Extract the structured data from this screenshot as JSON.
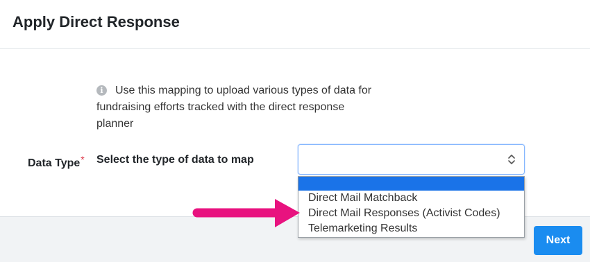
{
  "header": {
    "title": "Apply Direct Response"
  },
  "info": {
    "icon": "info-icon",
    "text": "Use this mapping to upload various types of data for fundraising efforts tracked with the direct response planner"
  },
  "field": {
    "label": "Data Type",
    "required_marker": "*",
    "description": "Select the type of data to map"
  },
  "select": {
    "value": "",
    "arrow_icon": "chevron-updown-icon",
    "options": [
      "",
      "Direct Mail Matchback",
      "Direct Mail Responses (Activist Codes)",
      "Telemarketing Results"
    ],
    "highlighted_index": 0
  },
  "footer": {
    "next_label": "Next"
  },
  "colors": {
    "accent": "#1a8cf0",
    "highlight": "#1a73e8",
    "required": "#dc3545",
    "annotation_arrow": "#e8127f"
  }
}
